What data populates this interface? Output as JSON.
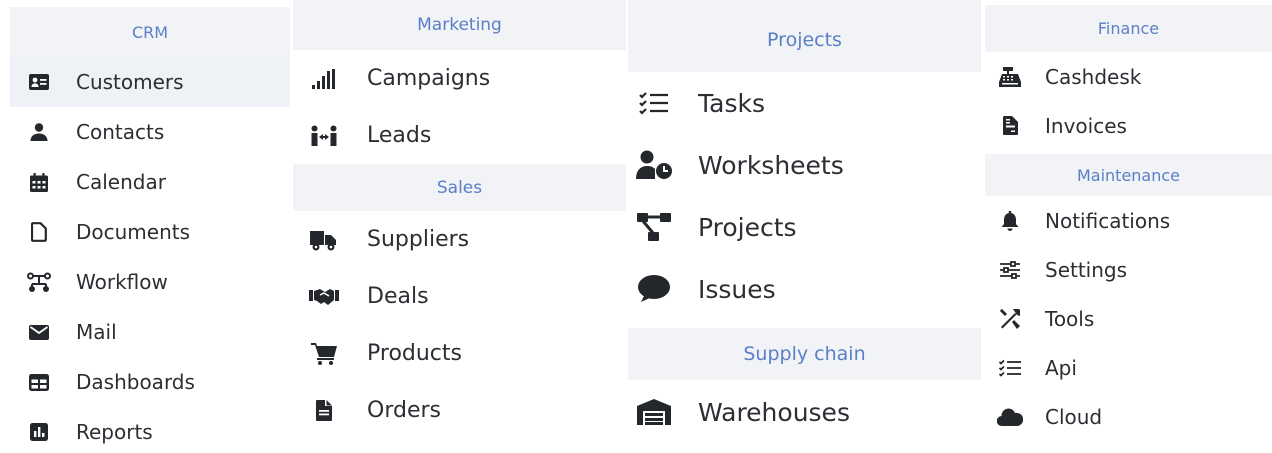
{
  "accent_color": "#5a7fc7",
  "header_bg": "#f1f3f6",
  "icon_color": "#24282c",
  "crm": {
    "title": "CRM",
    "items": [
      {
        "label": "Customers",
        "icon": "id-card-icon",
        "active": true
      },
      {
        "label": "Contacts",
        "icon": "user-icon"
      },
      {
        "label": "Calendar",
        "icon": "calendar-icon"
      },
      {
        "label": "Documents",
        "icon": "document-icon"
      },
      {
        "label": "Workflow",
        "icon": "workflow-icon"
      },
      {
        "label": "Mail",
        "icon": "envelope-icon"
      },
      {
        "label": "Dashboards",
        "icon": "dashboard-icon"
      },
      {
        "label": "Reports",
        "icon": "chart-report-icon"
      }
    ]
  },
  "marketing": {
    "title": "Marketing",
    "items": [
      {
        "label": "Campaigns",
        "icon": "signal-bars-icon"
      },
      {
        "label": "Leads",
        "icon": "people-arrows-icon"
      }
    ]
  },
  "sales": {
    "title": "Sales",
    "items": [
      {
        "label": "Suppliers",
        "icon": "truck-icon"
      },
      {
        "label": "Deals",
        "icon": "handshake-icon"
      },
      {
        "label": "Products",
        "icon": "cart-icon"
      },
      {
        "label": "Orders",
        "icon": "file-icon"
      }
    ]
  },
  "projects": {
    "title": "Projects",
    "items": [
      {
        "label": "Tasks",
        "icon": "checklist-icon"
      },
      {
        "label": "Worksheets",
        "icon": "user-clock-icon"
      },
      {
        "label": "Projects",
        "icon": "project-diagram-icon"
      },
      {
        "label": "Issues",
        "icon": "comment-icon"
      }
    ]
  },
  "supply_chain": {
    "title": "Supply chain",
    "items": [
      {
        "label": "Warehouses",
        "icon": "warehouse-icon"
      }
    ]
  },
  "finance": {
    "title": "Finance",
    "items": [
      {
        "label": "Cashdesk",
        "icon": "cash-register-icon"
      },
      {
        "label": "Invoices",
        "icon": "invoice-icon"
      }
    ]
  },
  "maintenance": {
    "title": "Maintenance",
    "items": [
      {
        "label": "Notifications",
        "icon": "bell-icon"
      },
      {
        "label": "Settings",
        "icon": "sliders-icon"
      },
      {
        "label": "Tools",
        "icon": "tools-icon"
      },
      {
        "label": "Api",
        "icon": "checklist-icon"
      },
      {
        "label": "Cloud",
        "icon": "cloud-icon"
      }
    ]
  }
}
